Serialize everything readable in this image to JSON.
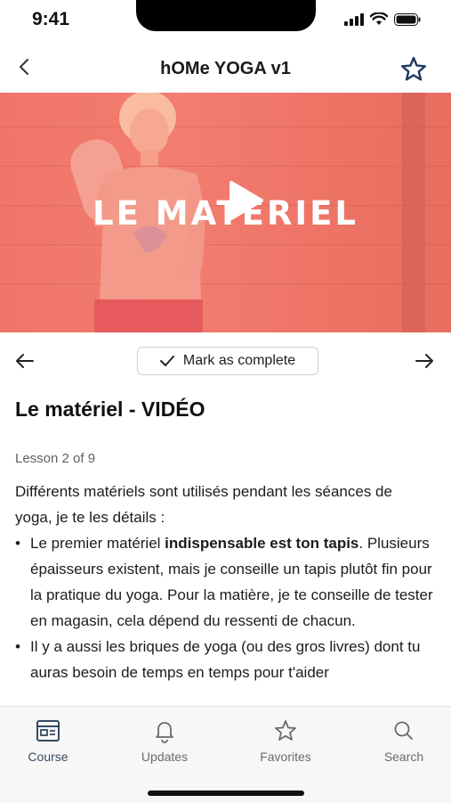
{
  "status": {
    "time": "9:41"
  },
  "nav": {
    "title": "hOMe YOGA v1",
    "back_icon": "chevron-left-icon",
    "favorite_icon": "star-outline-icon"
  },
  "video": {
    "overlay_title": "LE MATERIEL",
    "play_icon": "play-icon",
    "tint": "#f07568"
  },
  "lesson_nav": {
    "mark_complete_label": "Mark as complete",
    "prev_icon": "arrow-left-icon",
    "next_icon": "arrow-right-icon"
  },
  "lesson": {
    "title": "Le matériel - VIDÉO",
    "count": "Lesson 2 of 9",
    "intro": "Différents matériels sont utilisés pendant les séances de yoga, je te les détails :",
    "bullet1_pre": "Le premier matériel ",
    "bullet1_bold": "indispensable est ton tapis",
    "bullet1_post": ". Plusieurs épaisseurs existent, mais je conseille un tapis plutôt fin pour la pratique du yoga. Pour la matière, je te conseille de tester en magasin, cela dépend du ressenti de chacun.",
    "bullet2": "Il y a aussi les briques de yoga (ou des gros livres) dont tu auras besoin de temps en temps pour t'aider"
  },
  "tabs": [
    {
      "label": "Course",
      "icon": "course-calendar-icon"
    },
    {
      "label": "Updates",
      "icon": "bell-icon"
    },
    {
      "label": "Favorites",
      "icon": "star-icon"
    },
    {
      "label": "Search",
      "icon": "search-icon"
    }
  ],
  "colors": {
    "accent": "#344a62",
    "inactive": "#6b6b6b",
    "star": "#1e3a5f"
  }
}
